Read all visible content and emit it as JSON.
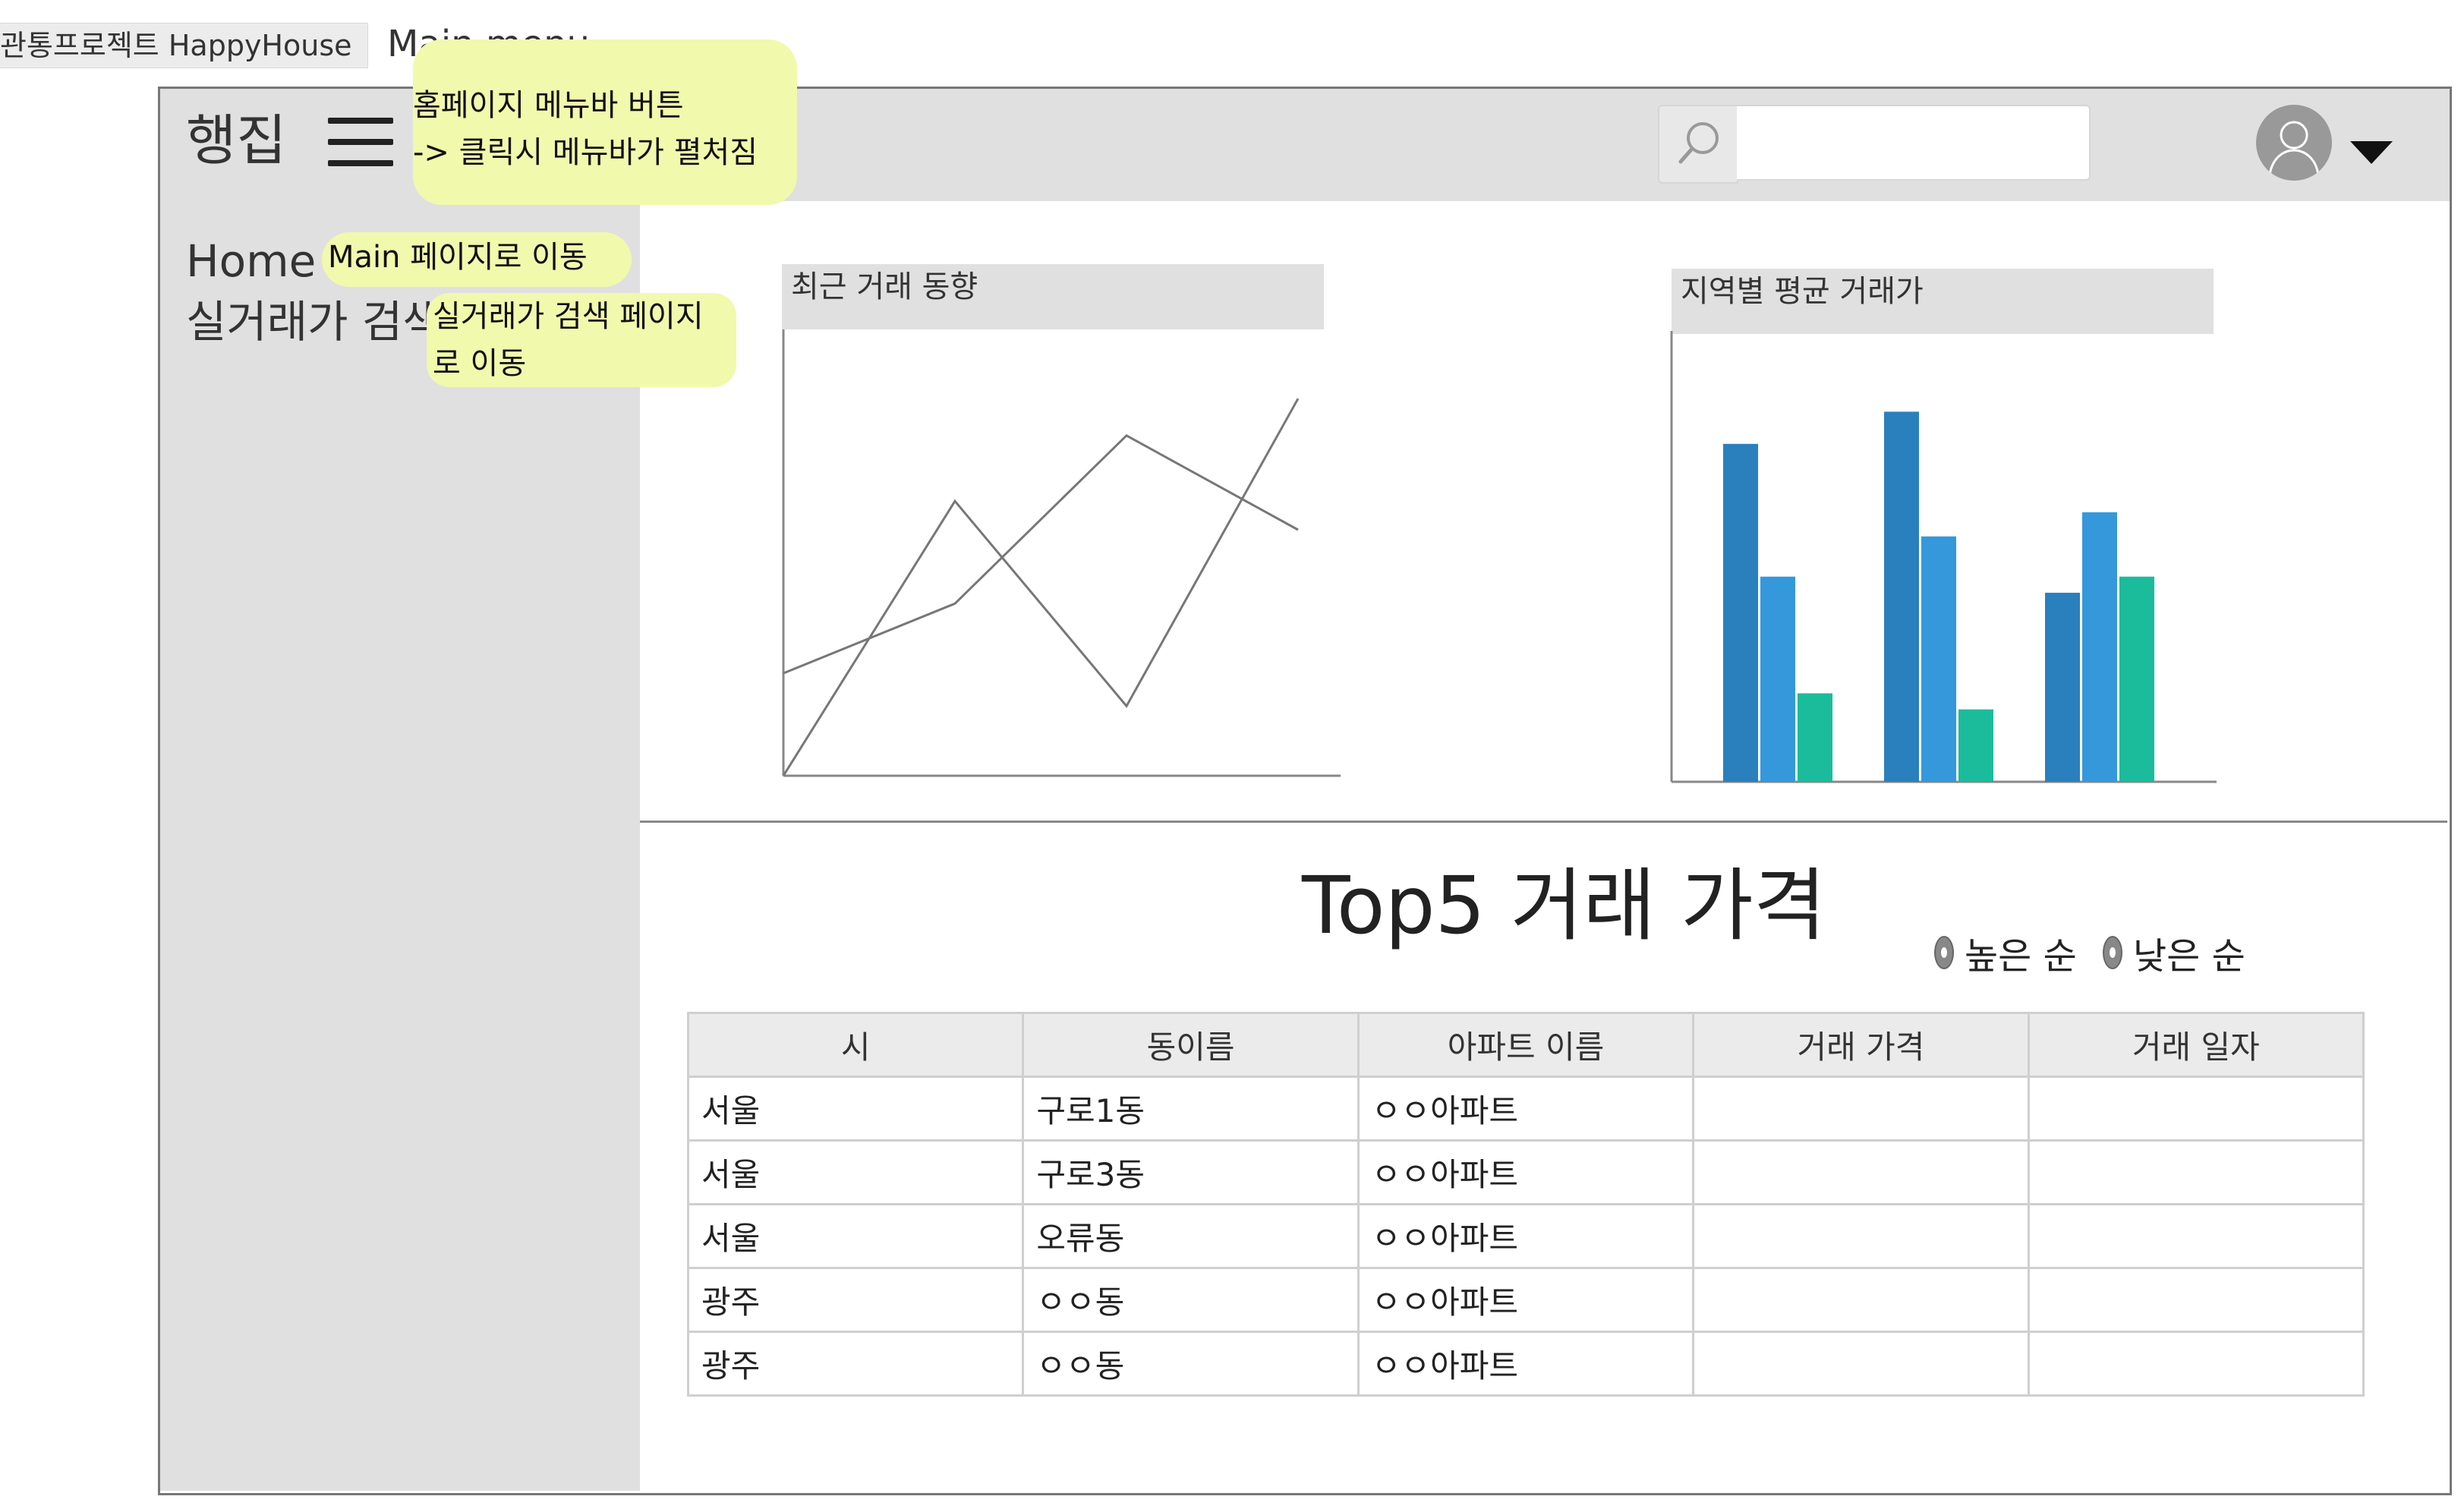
{
  "tab": {
    "label": "관통프로젝트 HappyHouse"
  },
  "page_name": "Main menu",
  "header": {
    "brand": "행집",
    "search": {
      "value": "",
      "placeholder": ""
    }
  },
  "sidebar": {
    "items": [
      {
        "label": "Home"
      },
      {
        "label": "실거래가 검색"
      }
    ]
  },
  "notes": {
    "menu_button": [
      "홈페이지 메뉴바 버튼",
      "-> 클릭시 메뉴바가 펼처짐"
    ],
    "home": "Main 페이지로 이동",
    "search_page": [
      "실거래가 검색 페이지",
      "로 이동"
    ]
  },
  "line_chart": {
    "title": "최근 거래 동향"
  },
  "bar_chart": {
    "title": "지역별 평균 거래가"
  },
  "chart_data": [
    {
      "type": "line",
      "title": "최근 거래 동향",
      "x": [
        0,
        1,
        2,
        3
      ],
      "ylim": [
        0,
        100
      ],
      "grid": false,
      "series": [
        {
          "values": [
            25,
            42,
            83,
            60
          ],
          "color": "#777777"
        },
        {
          "values": [
            0,
            67,
            17,
            92
          ],
          "color": "#777777"
        }
      ]
    },
    {
      "type": "bar",
      "title": "지역별 평균 거래가",
      "categories": [
        "",
        "",
        ""
      ],
      "ylim": [
        0,
        100
      ],
      "grid": false,
      "series": [
        {
          "values": [
            84,
            92,
            47
          ],
          "color": "#2a7fbd"
        },
        {
          "values": [
            51,
            61,
            67
          ],
          "color": "#3498db"
        },
        {
          "values": [
            22,
            18,
            51
          ],
          "color": "#1abc9c"
        }
      ]
    }
  ],
  "top5": {
    "title": "Top5  거래 가격",
    "sort_options": [
      {
        "label": "높은 순"
      },
      {
        "label": "낮은 순"
      }
    ],
    "columns": [
      "시",
      "동이름",
      "아파트 이름",
      "거래 가격",
      "거래 일자"
    ],
    "rows": [
      [
        "서울",
        "구로1동",
        "ㅇㅇ아파트",
        "",
        ""
      ],
      [
        "서울",
        "구로3동",
        "ㅇㅇ아파트",
        "",
        ""
      ],
      [
        "서울",
        "오류동",
        "ㅇㅇ아파트",
        "",
        ""
      ],
      [
        "광주",
        "ㅇㅇ동",
        "ㅇㅇ아파트",
        "",
        ""
      ],
      [
        "광주",
        "ㅇㅇ동",
        "ㅇㅇ아파트",
        "",
        ""
      ]
    ]
  },
  "colors": {
    "topbar": "#e0e0e0",
    "sidebar": "#e0e0e0",
    "note": "#f1f9ad",
    "bar_series": [
      "#2a7fbd",
      "#3498db",
      "#1abc9c"
    ]
  }
}
